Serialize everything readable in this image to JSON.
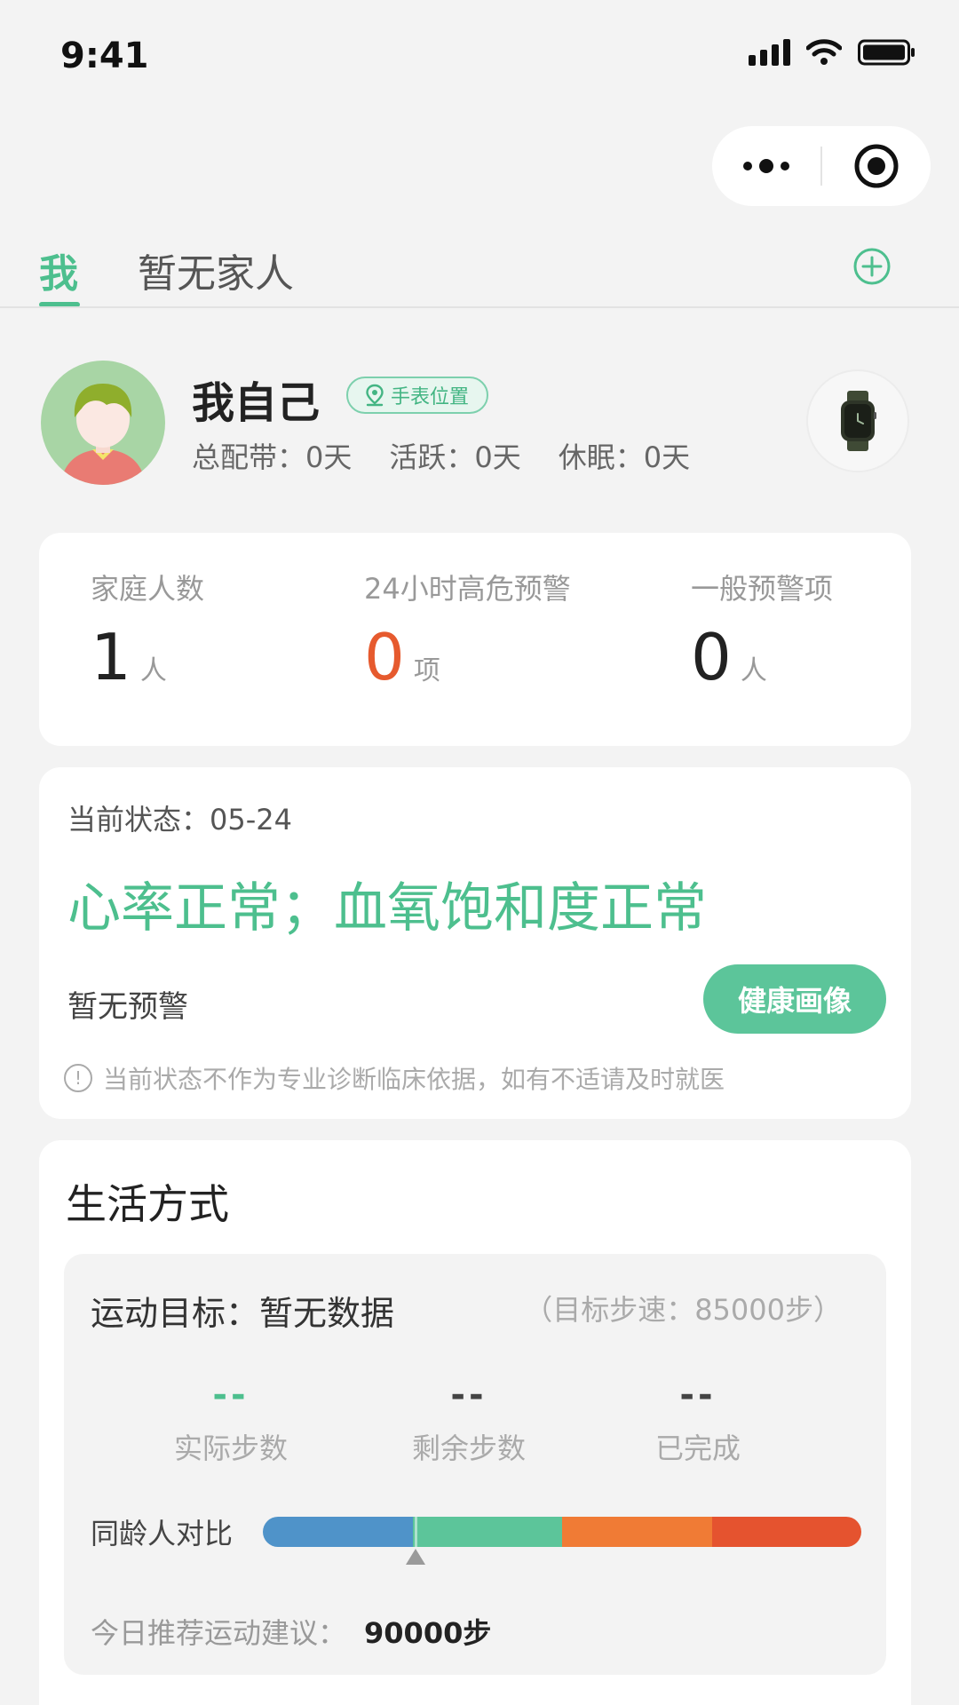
{
  "status_bar": {
    "time": "9:41"
  },
  "tabs": {
    "me": "我",
    "family": "暂无家人"
  },
  "profile": {
    "name": "我自己",
    "location_badge": "手表位置",
    "stats": {
      "total": "总配带：0天",
      "active": "活跃：0天",
      "sleep": "休眠：0天"
    }
  },
  "summary": {
    "family_count": {
      "label": "家庭人数",
      "value": "1",
      "unit": "人"
    },
    "high_risk": {
      "label": "24小时高危预警",
      "value": "0",
      "unit": "项"
    },
    "general": {
      "label": "一般预警项",
      "value": "0",
      "unit": "人"
    }
  },
  "status": {
    "date_line": "当前状态：05-24",
    "headline": "心率正常；血氧饱和度正常",
    "no_warning": "暂无预警",
    "button": "健康画像",
    "disclaimer": "当前状态不作为专业诊断临床依据，如有不适请及时就医"
  },
  "lifestyle": {
    "title": "生活方式",
    "goal": "运动目标：暂无数据",
    "target": "（目标步速：85000步）",
    "metrics": {
      "actual": {
        "value": "--",
        "label": "实际步数"
      },
      "remaining": {
        "value": "--",
        "label": "剩余步数"
      },
      "completed": {
        "value": "--",
        "label": "已完成"
      }
    },
    "compare_label": "同龄人对比",
    "compare_colors": [
      "#4f93c9",
      "#5cc59a",
      "#f07b35",
      "#e5532f"
    ],
    "recommend_label": "今日推荐运动建议：",
    "recommend_value": "90000步"
  },
  "colors": {
    "accent": "#4dbf8e",
    "alert": "#e65a2e"
  }
}
